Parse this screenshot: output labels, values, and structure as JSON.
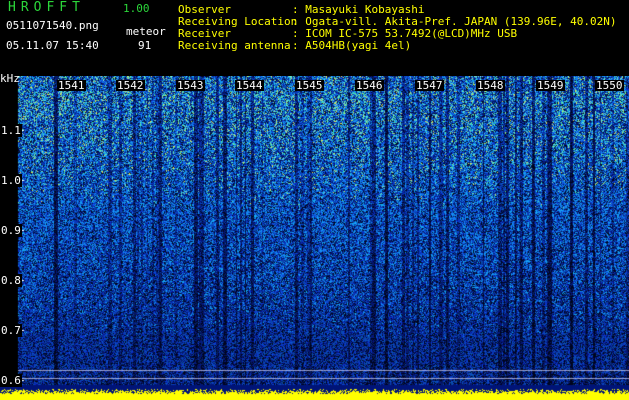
{
  "header": {
    "logo": "HROFFT",
    "version": "1.00",
    "filename": "0511071540.png",
    "date_time": "05.11.07 15:40",
    "meteor_label": "meteor",
    "meteor_count": "91"
  },
  "info": {
    "observer_label": "Observer",
    "observer_value": ": Masayuki Kobayashi",
    "location_label": "Receiving Location",
    "location_value": ": Ogata-vill. Akita-Pref. JAPAN (139.96E, 40.02N)",
    "receiver_label": "Receiver",
    "receiver_value": ": ICOM IC-575 53.7492(@LCD)MHz USB",
    "antenna_label": "Receiving antenna",
    "antenna_value": ": A504HB(yagi 4el)"
  },
  "spectrogram": {
    "unit": "kHz",
    "y_ticks": [
      "1.1",
      "1.0",
      "0.9",
      "0.8",
      "0.7",
      "0.6"
    ],
    "x_ticks": [
      "1541",
      "1542",
      "1543",
      "1544",
      "1545",
      "1546",
      "1547",
      "1548",
      "1549",
      "1550"
    ],
    "colors": {
      "background": "#000000",
      "low": "#0a1e8c",
      "mid": "#1e5aff",
      "high": "#30e0d0",
      "peak": "#ffff00"
    }
  }
}
